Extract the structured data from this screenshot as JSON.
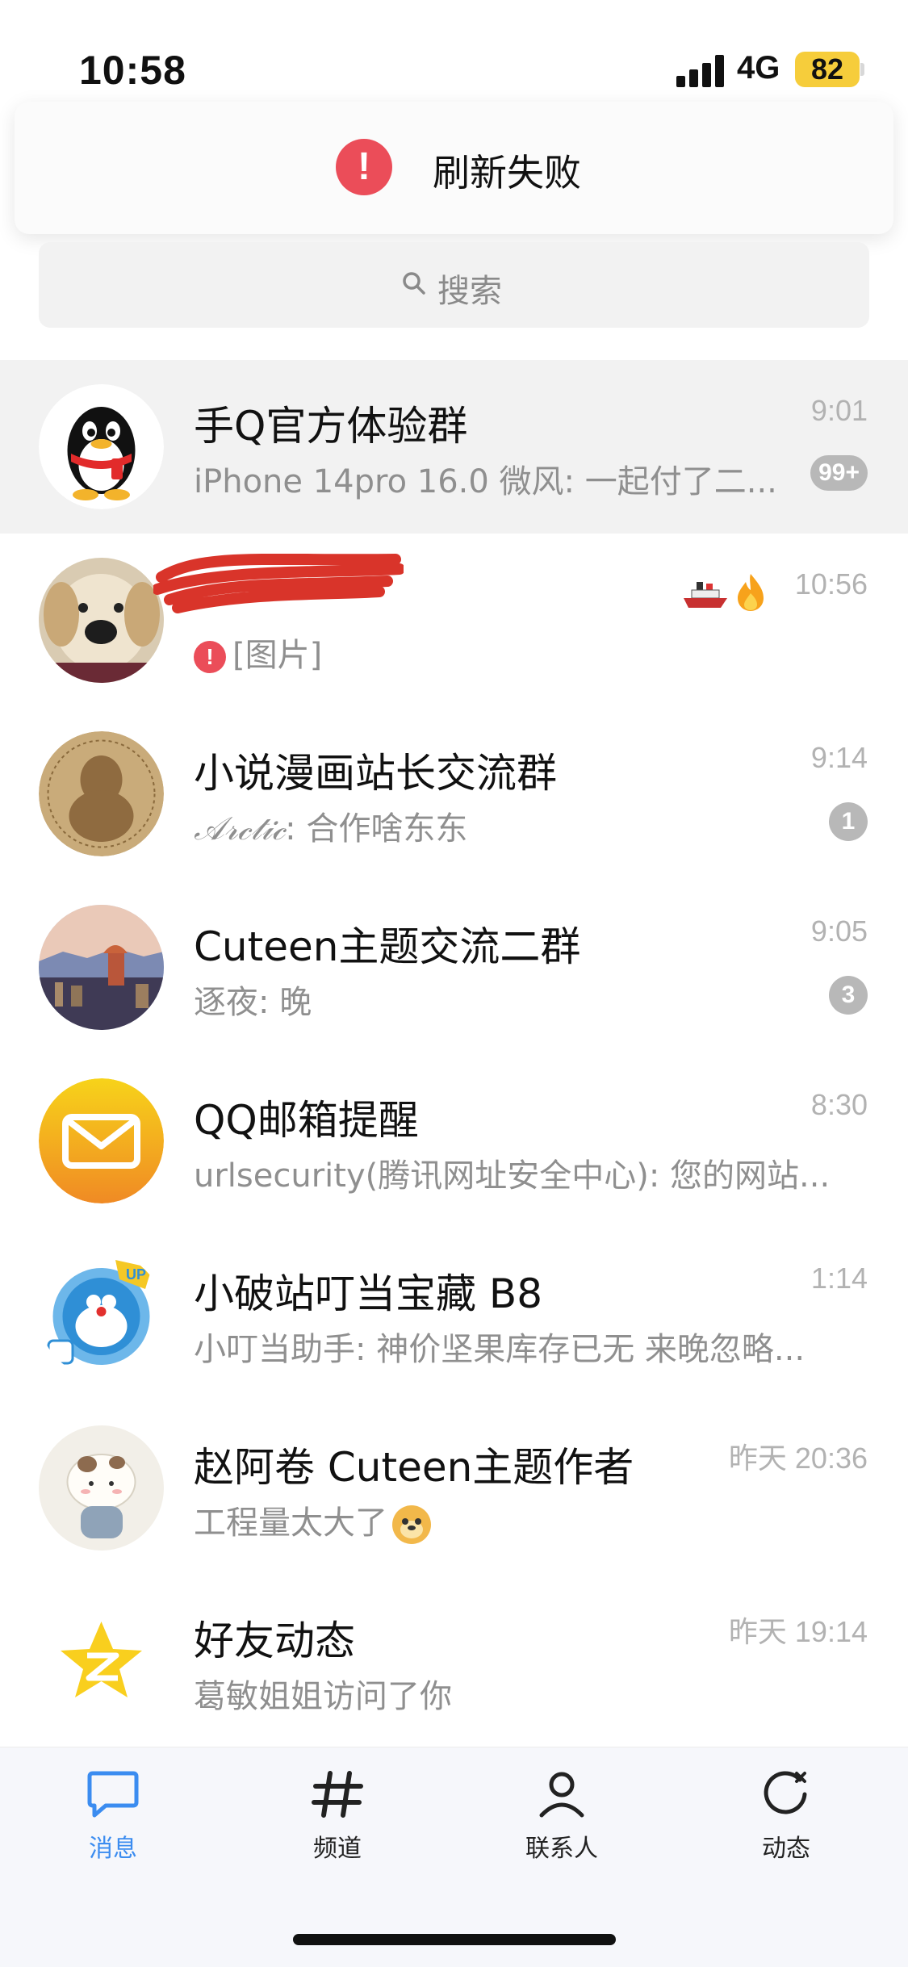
{
  "status_bar": {
    "time": "10:58",
    "network": "4G",
    "battery": "82"
  },
  "toast": {
    "text": "刷新失败",
    "icon": "error-icon"
  },
  "search": {
    "placeholder": "搜索"
  },
  "chats": [
    {
      "name": "手Q官方体验群",
      "preview": "iPhone 14pro 16.0 微风: 一起付了二...",
      "time": "9:01",
      "badge": "99+",
      "pinned": true,
      "avatar": "qq-penguin-avatar"
    },
    {
      "name": "",
      "preview": "[图片]",
      "time": "10:56",
      "badge": "",
      "avatar": "dog-avatar",
      "status": "send-failed"
    },
    {
      "name": "小说漫画站长交流群",
      "preview_sender": "𝒜𝓇𝒸𝓉𝒾𝒸",
      "preview": ": 合作啥东东",
      "time": "9:14",
      "badge": "1",
      "avatar": "group-silhouette-avatar"
    },
    {
      "name": "Cuteen主题交流二群",
      "preview": "逐夜: 晚",
      "time": "9:05",
      "badge": "3",
      "avatar": "city-avatar"
    },
    {
      "name": "QQ邮箱提醒",
      "preview": "urlsecurity(腾讯网址安全中心): 您的网站...",
      "time": "8:30",
      "badge": "",
      "avatar": "mail-avatar"
    },
    {
      "name": "小破站叮当宝藏 B8",
      "preview": "小叮当助手: 神价坚果库存已无 来晚忽略...",
      "time": "1:14",
      "badge": "",
      "avatar": "doraemon-avatar"
    },
    {
      "name": "赵阿卷 Cuteen主题作者",
      "preview": "工程量太大了",
      "time": "昨天 20:36",
      "badge": "",
      "avatar": "cat-avatar"
    },
    {
      "name": "好友动态",
      "preview": "葛敏姐姐访问了你",
      "time": "昨天 19:14",
      "badge": "",
      "avatar": "qzone-star-avatar"
    }
  ],
  "tabs": [
    {
      "label": "消息",
      "icon": "message-icon",
      "active": true
    },
    {
      "label": "频道",
      "icon": "channel-hash-icon"
    },
    {
      "label": "联系人",
      "icon": "contacts-icon"
    },
    {
      "label": "动态",
      "icon": "activity-icon"
    }
  ],
  "colors": {
    "accent": "#3b8cf0",
    "error": "#eb4d59",
    "badge": "#b8b8b8",
    "battery": "#f6cd3b"
  }
}
